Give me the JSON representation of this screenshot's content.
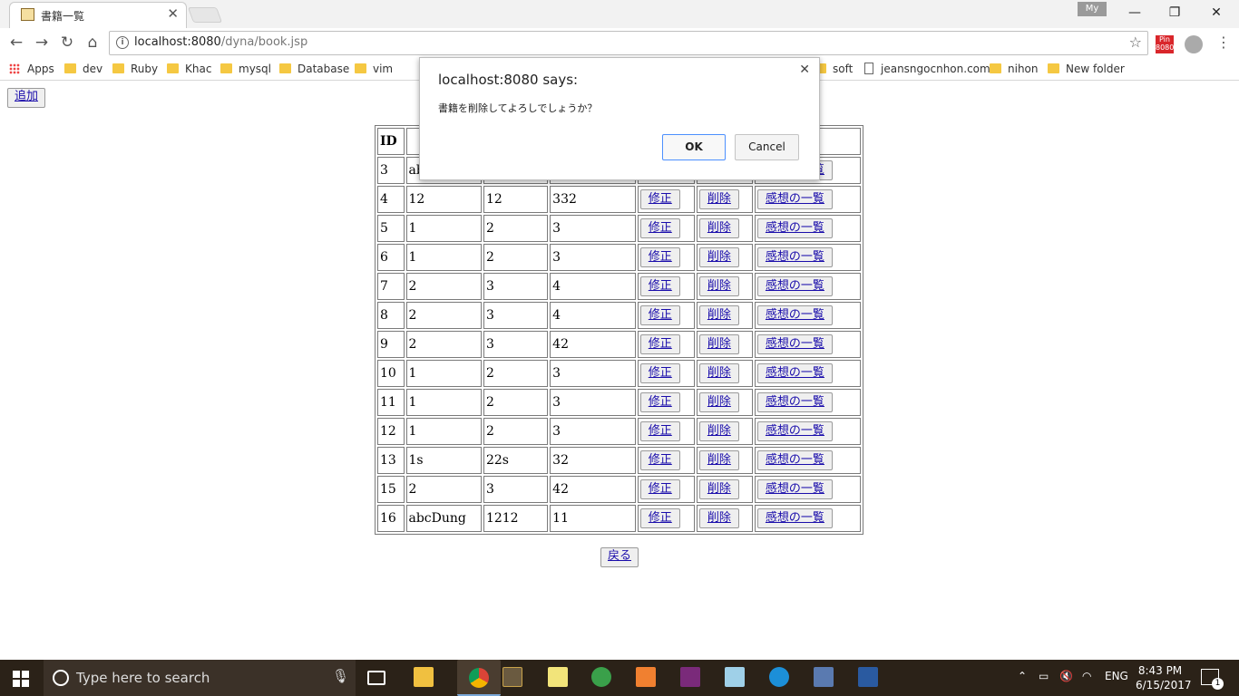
{
  "browser": {
    "tab_title": "書籍一覧",
    "profile_label": "My",
    "url_host": "localhost:8080",
    "url_path": "/dyna/book.jsp",
    "ext_label": "Pin 8080"
  },
  "bookmarks": [
    {
      "label": "Apps"
    },
    {
      "label": "dev"
    },
    {
      "label": "Ruby"
    },
    {
      "label": "Khac"
    },
    {
      "label": "mysql"
    },
    {
      "label": "Database"
    },
    {
      "label": "vim"
    },
    {
      "label": "soft"
    },
    {
      "label": "jeansngocnhon.com"
    },
    {
      "label": "nihon"
    },
    {
      "label": "New folder"
    }
  ],
  "page": {
    "add_label": "追加",
    "back_label": "戻る",
    "table": {
      "header_id": "ID",
      "edit_label": "修正",
      "delete_label": "削除",
      "review_label": "感想の一覧",
      "rows": [
        {
          "id": "3",
          "c1": "ab",
          "c2": "",
          "c3": ""
        },
        {
          "id": "4",
          "c1": "12",
          "c2": "12",
          "c3": "332"
        },
        {
          "id": "5",
          "c1": "1",
          "c2": "2",
          "c3": "3"
        },
        {
          "id": "6",
          "c1": "1",
          "c2": "2",
          "c3": "3"
        },
        {
          "id": "7",
          "c1": "2",
          "c2": "3",
          "c3": "4"
        },
        {
          "id": "8",
          "c1": "2",
          "c2": "3",
          "c3": "4"
        },
        {
          "id": "9",
          "c1": "2",
          "c2": "3",
          "c3": "42"
        },
        {
          "id": "10",
          "c1": "1",
          "c2": "2",
          "c3": "3"
        },
        {
          "id": "11",
          "c1": "1",
          "c2": "2",
          "c3": "3"
        },
        {
          "id": "12",
          "c1": "1",
          "c2": "2",
          "c3": "3"
        },
        {
          "id": "13",
          "c1": "1s",
          "c2": "22s",
          "c3": "32"
        },
        {
          "id": "15",
          "c1": "2",
          "c2": "3",
          "c3": "42"
        },
        {
          "id": "16",
          "c1": "abcDung",
          "c2": "1212",
          "c3": "11"
        }
      ]
    }
  },
  "dialog": {
    "title": "localhost:8080 says:",
    "message": "書籍を削除してよろしでしょうか？",
    "ok_label": "OK",
    "cancel_label": "Cancel"
  },
  "taskbar": {
    "search_placeholder": "Type here to search",
    "lang": "ENG",
    "time": "8:43 PM",
    "date": "6/15/2017",
    "notification_count": "1"
  }
}
